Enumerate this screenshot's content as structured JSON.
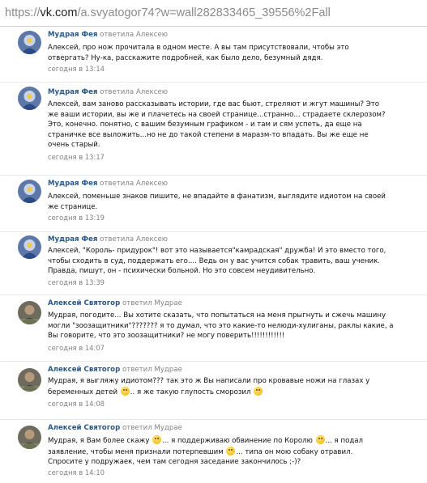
{
  "browser": {
    "url_scheme": "https://",
    "url_host": "vk.com",
    "url_path": "/a.svyatogor74?w=wall282833465_39556%2Fall"
  },
  "replies": [
    {
      "author": "Мудрая Фея",
      "action": "ответила Алексею",
      "lines": [
        "Алексей, про нож прочитала в одном месте. А вы там присутствовали, чтобы это",
        "отвергать? Ну-ка, расскажите подробней, как было дело, безумный дядя."
      ],
      "time": "сегодня в 13:14"
    },
    {
      "author": "Мудрая Фея",
      "action": "ответила Алексею",
      "lines": [
        "Алексей, вам заново рассказывать истории, где вас бьют, стреляют и жгут машины? Это",
        "же ваши истории, вы же и плачетесь на своей странице...странно... страдаете склерозом?",
        "Это, конечно. понятно, с вашим безумным графиком - и там и сям успеть, да еще на",
        "страничке все выложить...но не до такой степени в маразм-то впадать. Вы же еще не",
        "очень старый."
      ],
      "time": "сегодня в 13:17"
    },
    {
      "author": "Мудрая Фея",
      "action": "ответила Алексею",
      "lines": [
        "Алексей, поменьше знаков пишите, не впадайте в фанатизм, выглядите идиотом на своей",
        "же странице."
      ],
      "time": "сегодня в 13:19"
    },
    {
      "author": "Мудрая Фея",
      "action": "ответила Алексею",
      "lines": [
        "Алексей, \"Король- придурок\"! вот это называется\"камрадская\" дружба! И это вместо того,",
        "чтобы сходить в суд, поддержать его.... Ведь он у вас учится собак травить, ваш ученик.",
        "Правда, пишут, он - психически больной. Но это совсем неудивительно."
      ],
      "time": "сегодня в 13:39"
    },
    {
      "author": "Алексей Святогор",
      "action": "ответил Мудрае",
      "lines": [
        "Мудрая, погодите... Вы хотите сказать, что попытаться на меня прыгнуть и сжечь машину",
        "могли \"зоозащитники\"??????? я то думал, что это какие-то нелюди-хулиганы, раклы какие, а",
        "Вы говорите, что это зоозащитники? не могу поверить!!!!!!!!!!!!"
      ],
      "time": "сегодня в 14:07"
    },
    {
      "author": "Алексей Святогор",
      "action": "ответил Мудрае",
      "lines": [
        "Мудрая, я выгляжу идиотом??? так это ж Вы написали про кровавые ножи на глазах у",
        "беременных детей",
        ".. я же такую глупость сморозил"
      ],
      "time": "сегодня в 14:08"
    },
    {
      "author": "Алексей Святогор",
      "action": "ответил Мудрае",
      "lines": [
        "Мудрая, я Вам более скажу",
        "... я поддерживаю обвинение по Королю",
        "... я подал",
        "заявление, чтобы меня признали потерпевшим",
        "... типа он мою собаку отравил.",
        "Спросите у подружаек, чем там сегодня заседание закончилось ;-)?"
      ],
      "time": "сегодня в 14:10"
    }
  ]
}
